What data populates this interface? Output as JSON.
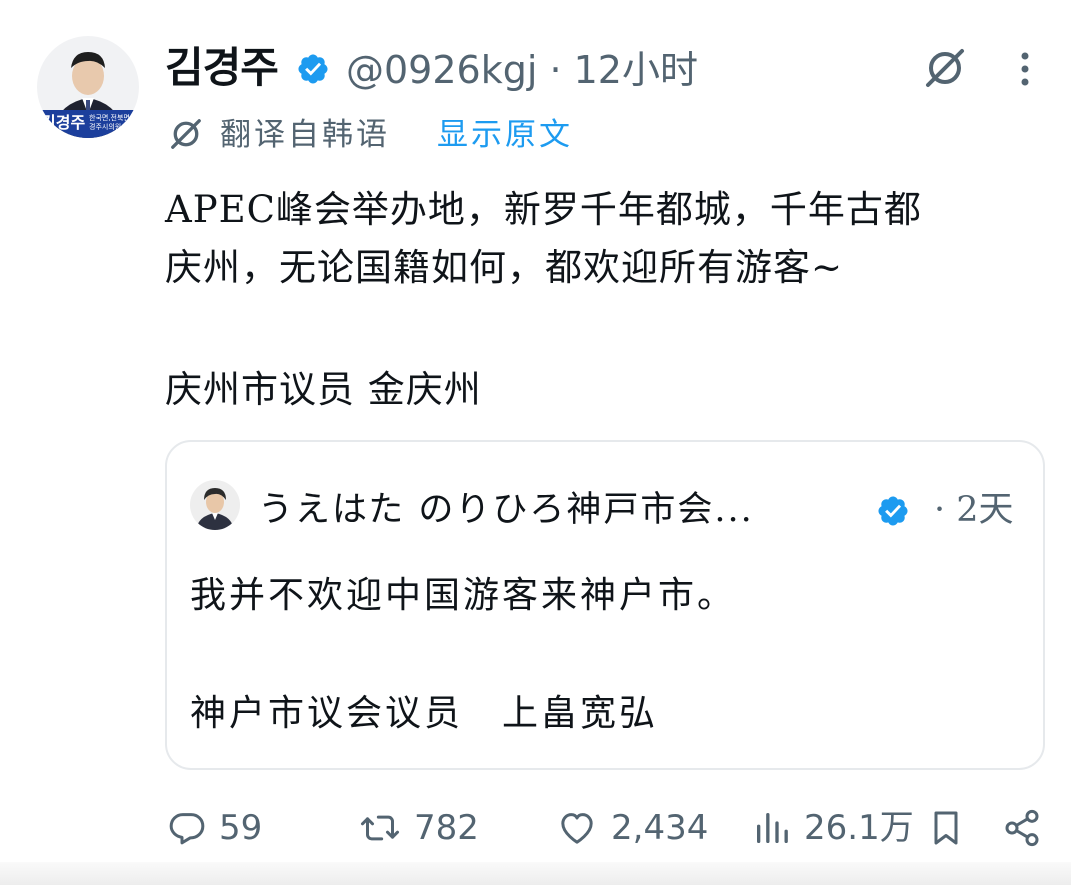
{
  "tweet": {
    "author_name": "김경주",
    "handle_time": "@0926kgj · 12小时",
    "avatar_badge": "김경주",
    "avatar_badge_sub": "한국면,전북면 경주시의원",
    "translation_label": "翻译自韩语",
    "show_original": "显示原文",
    "body_lines": [
      "APEC峰会举办地，新罗千年都城，千年古都",
      "庆州，无论国籍如何，都欢迎所有游客~",
      "庆州市议员 金庆州"
    ]
  },
  "quote": {
    "author_name": "うえはた のりひろ神戸市会...",
    "time": "· 2天",
    "lines": [
      "我并不欢迎中国游客来神户市。",
      "神户市议会议员　上畠宽弘"
    ]
  },
  "actions": {
    "replies": "59",
    "reposts": "782",
    "likes": "2,434",
    "views": "26.1万"
  },
  "colors": {
    "verified": "#1d9bf0",
    "link": "#1d9bf0",
    "muted": "#536471"
  },
  "icons": [
    "grok-icon",
    "more-icon",
    "translate-icon",
    "reply-icon",
    "repost-icon",
    "like-icon",
    "views-icon",
    "bookmark-icon",
    "share-icon",
    "verified-icon"
  ]
}
